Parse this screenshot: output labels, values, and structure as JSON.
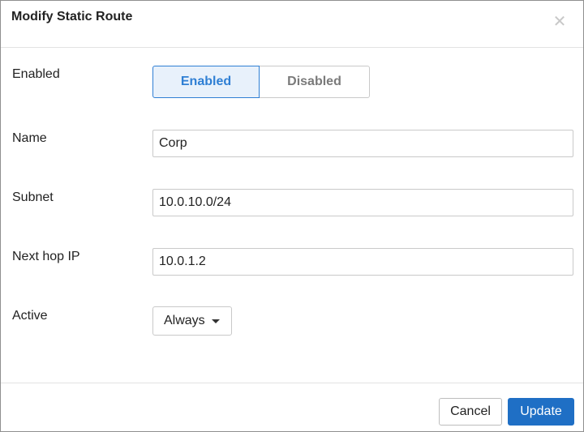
{
  "dialog": {
    "title": "Modify Static Route",
    "close_icon": "close-icon"
  },
  "form": {
    "enabled": {
      "label": "Enabled",
      "options": [
        "Enabled",
        "Disabled"
      ],
      "selected": "Enabled"
    },
    "name": {
      "label": "Name",
      "value": "Corp"
    },
    "subnet": {
      "label": "Subnet",
      "value": "10.0.10.0/24"
    },
    "next_hop": {
      "label": "Next hop IP",
      "value": "10.0.1.2"
    },
    "active": {
      "label": "Active",
      "value": "Always"
    }
  },
  "footer": {
    "cancel_label": "Cancel",
    "update_label": "Update"
  },
  "colors": {
    "accent": "#2f7fd4",
    "primary_button": "#1f6fc5",
    "selected_bg": "#e8f1fb"
  }
}
